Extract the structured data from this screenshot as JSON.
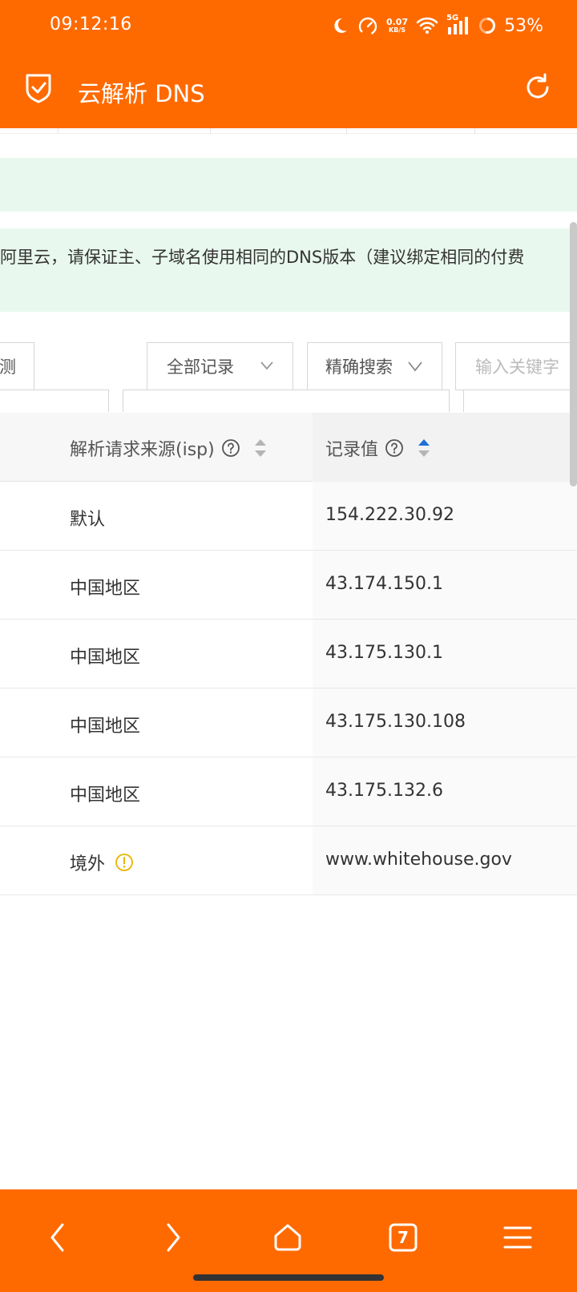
{
  "status_bar": {
    "time": "09:12:16",
    "net_speed_value": "0.07",
    "net_speed_unit": "KB/S",
    "signal_label": "5G",
    "battery": "53%"
  },
  "header": {
    "title": "云解析 DNS"
  },
  "notice": {
    "text": "阿里云，请保证主、子域名使用相同的DNS版本（建议绑定相同的付费"
  },
  "filters": {
    "left_label": "测",
    "record_filter": "全部记录",
    "search_mode": "精确搜索",
    "keyword_placeholder": "输入关键字"
  },
  "table": {
    "columns": {
      "isp": "解析请求来源(isp)",
      "value": "记录值"
    },
    "rows": [
      {
        "isp": "默认",
        "value": "154.222.30.92",
        "warn": false
      },
      {
        "isp": "中国地区",
        "value": "43.174.150.1",
        "warn": false
      },
      {
        "isp": "中国地区",
        "value": "43.175.130.1",
        "warn": false
      },
      {
        "isp": "中国地区",
        "value": "43.175.130.108",
        "warn": false
      },
      {
        "isp": "中国地区",
        "value": "43.175.132.6",
        "warn": false
      },
      {
        "isp": "境外",
        "value": "www.whitehouse.gov",
        "warn": true
      }
    ]
  },
  "bottom_nav": {
    "tab_count": "7"
  },
  "colors": {
    "brand": "#FF6A00",
    "notice_bg": "#E9F8EE",
    "sort_active": "#1E6FD9",
    "warn": "#E8B400"
  }
}
